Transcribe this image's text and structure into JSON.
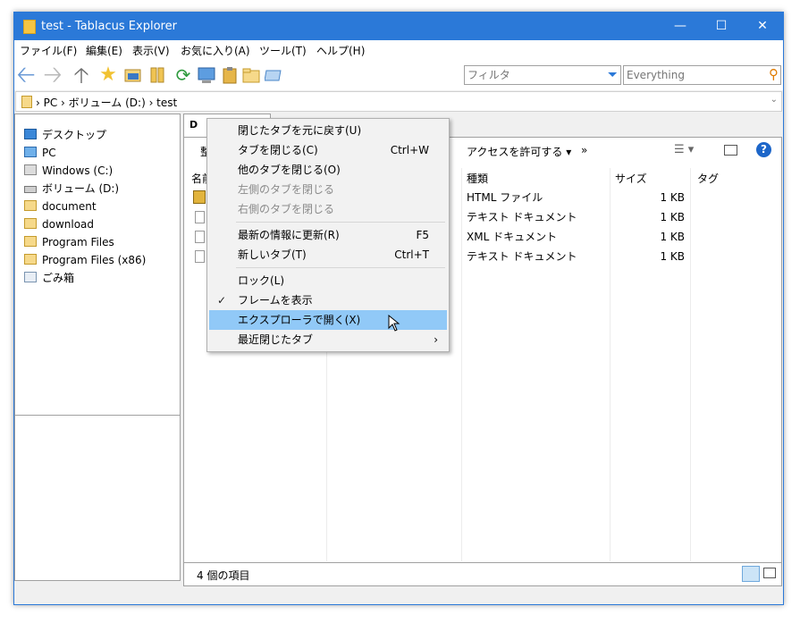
{
  "window": {
    "title": "test - Tablacus Explorer"
  },
  "menu": [
    "ファイル(F)",
    "編集(E)",
    "表示(V)",
    "お気に入り(A)",
    "ツール(T)",
    "ヘルプ(H)"
  ],
  "toolbar": {
    "filter_placeholder": "フィルタ",
    "everything_placeholder": "Everything"
  },
  "address": {
    "path": "› PC › ボリューム (D:) › test"
  },
  "tree": {
    "items": [
      {
        "label": "デスクトップ",
        "icon": "desktop-icon"
      },
      {
        "label": "PC",
        "icon": "pc-icon"
      },
      {
        "label": "Windows (C:)",
        "icon": "windows-drive-icon"
      },
      {
        "label": "ボリューム (D:)",
        "icon": "drive-icon"
      },
      {
        "label": "document",
        "icon": "folder-icon"
      },
      {
        "label": "download",
        "icon": "folder-icon"
      },
      {
        "label": "Program Files",
        "icon": "folder-icon"
      },
      {
        "label": "Program Files (x86)",
        "icon": "folder-icon"
      },
      {
        "label": "ごみ箱",
        "icon": "recycle-bin-icon"
      }
    ]
  },
  "tab": {
    "label": "D"
  },
  "commandbar": {
    "organize": "整",
    "share": "アクセスを許可する ▾",
    "more": "»"
  },
  "columns": {
    "name": "名前",
    "type": "種類",
    "size": "サイズ",
    "tag": "タグ"
  },
  "files": [
    {
      "type": "HTML ファイル",
      "size": "1 KB"
    },
    {
      "type": "テキスト ドキュメント",
      "size": "1 KB"
    },
    {
      "type": "XML ドキュメント",
      "size": "1 KB"
    },
    {
      "type": "テキスト ドキュメント",
      "size": "1 KB"
    }
  ],
  "status": {
    "count": "4 個の項目"
  },
  "context_menu": {
    "items": [
      {
        "label": "閉じたタブを元に戻す(U)",
        "shortcut": ""
      },
      {
        "label": "タブを閉じる(C)",
        "shortcut": "Ctrl+W"
      },
      {
        "label": "他のタブを閉じる(O)",
        "shortcut": ""
      },
      {
        "label": "左側のタブを閉じる",
        "shortcut": ""
      },
      {
        "label": "右側のタブを閉じる",
        "shortcut": ""
      },
      {
        "label": "最新の情報に更新(R)",
        "shortcut": "F5"
      },
      {
        "label": "新しいタブ(T)",
        "shortcut": "Ctrl+T"
      },
      {
        "label": "ロック(L)",
        "shortcut": ""
      },
      {
        "label": "フレームを表示",
        "shortcut": ""
      },
      {
        "label": "エクスプローラで開く(X)",
        "shortcut": ""
      },
      {
        "label": "最近閉じたタブ",
        "shortcut": "›"
      }
    ]
  },
  "colors": {
    "accent": "#2b79d8",
    "highlight": "#91c9f7"
  }
}
